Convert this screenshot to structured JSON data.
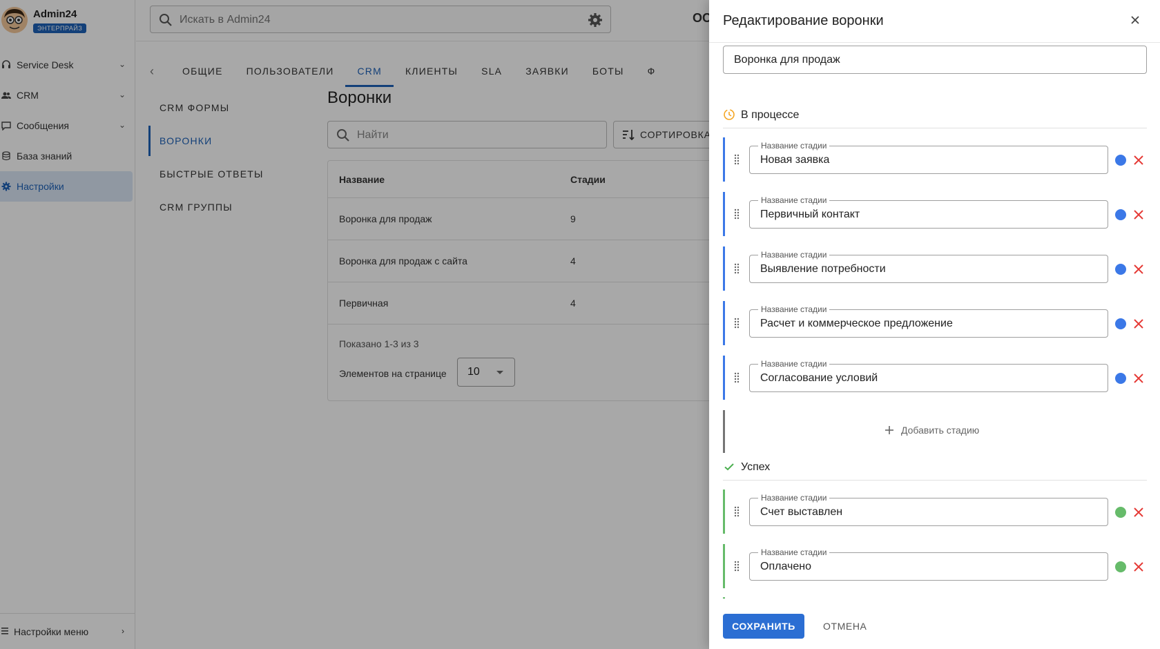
{
  "sidebar": {
    "brand": {
      "name": "Admin24",
      "badge": "ЭНТЕРПРАЙЗ"
    },
    "items": [
      {
        "label": "Service Desk",
        "icon": "headset-icon",
        "expandable": true
      },
      {
        "label": "CRM",
        "icon": "people-icon",
        "expandable": true
      },
      {
        "label": "Сообщения",
        "icon": "chat-icon",
        "expandable": true
      },
      {
        "label": "База знаний",
        "icon": "database-icon",
        "expandable": false
      },
      {
        "label": "Настройки",
        "icon": "gear-icon",
        "expandable": false,
        "active": true
      }
    ],
    "footer_label": "Настройки меню"
  },
  "topbar": {
    "search_placeholder": "Искать в Admin24",
    "extra_text": "OO"
  },
  "tabs": [
    "ОБЩИЕ",
    "ПОЛЬЗОВАТЕЛИ",
    "CRM",
    "КЛИЕНТЫ",
    "SLA",
    "ЗАЯВКИ",
    "БОТЫ",
    "Ф"
  ],
  "active_tab": "CRM",
  "subnav": {
    "items": [
      "CRM ФОРМЫ",
      "ВОРОНКИ",
      "БЫСТРЫЕ ОТВЕТЫ",
      "CRM ГРУППЫ"
    ],
    "active": "ВОРОНКИ"
  },
  "content": {
    "title": "Воронки",
    "search_placeholder": "Найти",
    "sort_label": "СОРТИРОВКА",
    "table": {
      "headers": {
        "name": "Название",
        "stages": "Стадии"
      },
      "rows": [
        {
          "name": "Воронка для продаж",
          "stages": "9"
        },
        {
          "name": "Воронка для продаж с сайта",
          "stages": "4"
        },
        {
          "name": "Первичная",
          "stages": "4"
        }
      ],
      "shown": "Показано 1-3 из 3",
      "per_page_label": "Элементов на странице",
      "per_page_value": "10"
    }
  },
  "drawer": {
    "title": "Редактирование воронки",
    "funnel_name": "Воронка для продаж",
    "stage_field_label": "Название стадии",
    "groups": {
      "in_progress": {
        "label": "В процессе",
        "color": "#f5a623",
        "stages": [
          "Новая заявка",
          "Первичный контакт",
          "Выявление потребности",
          "Расчет и коммерческое предложение",
          "Согласование условий"
        ],
        "stage_color": "#3b78e7"
      },
      "add_stage_label": "Добавить стадию",
      "success": {
        "label": "Успех",
        "color": "#4caf50",
        "stages": [
          "Счет выставлен",
          "Оплачено"
        ],
        "stage_color": "#66bb6a"
      }
    },
    "save_label": "СОХРАНИТЬ",
    "cancel_label": "ОТМЕНА",
    "delete_color": "#e53935"
  }
}
